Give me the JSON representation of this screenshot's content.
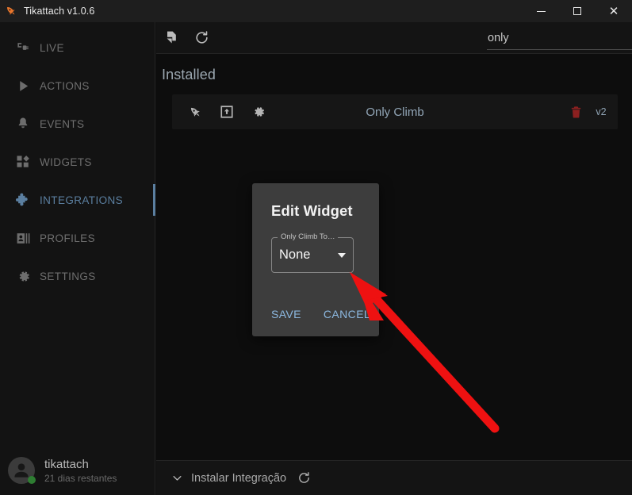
{
  "window": {
    "title": "Tikattach v1.0.6",
    "app_icon": "rocket-icon",
    "minimize_label": "",
    "maximize_label": "",
    "close_label": "✕"
  },
  "sidebar": {
    "items": [
      {
        "label": "LIVE",
        "icon": "plug-icon",
        "active": false
      },
      {
        "label": "ACTIONS",
        "icon": "play-icon",
        "active": false
      },
      {
        "label": "EVENTS",
        "icon": "bell-icon",
        "active": false
      },
      {
        "label": "WIDGETS",
        "icon": "widgets-icon",
        "active": false
      },
      {
        "label": "INTEGRATIONS",
        "icon": "puzzle-icon",
        "active": true
      },
      {
        "label": "PROFILES",
        "icon": "profile-card-icon",
        "active": false
      },
      {
        "label": "SETTINGS",
        "icon": "gear-icon",
        "active": false
      }
    ],
    "user": {
      "name": "tikattach",
      "subtitle": "21 dias restantes",
      "status_color": "#2e7d32"
    }
  },
  "toolbar": {
    "new_file_icon": "file-add-icon",
    "refresh_icon": "refresh-icon",
    "search": {
      "value": "only",
      "placeholder": ""
    }
  },
  "main": {
    "section_title": "Installed",
    "rows": [
      {
        "name": "Only Climb",
        "version": "v2",
        "icons": [
          "rocket-icon",
          "export-icon",
          "gear-icon"
        ],
        "delete_icon": "trash-icon"
      }
    ]
  },
  "bottom_bar": {
    "chevron_icon": "chevron-down-icon",
    "label": "Instalar Integração",
    "refresh_icon": "refresh-icon"
  },
  "dialog": {
    "title": "Edit Widget",
    "field": {
      "label": "Only Climb To…",
      "value": "None",
      "caret_icon": "chevron-down-icon"
    },
    "save_label": "SAVE",
    "cancel_label": "CANCEL"
  },
  "annotation": {
    "arrow_color": "#ee1111",
    "points_at": "widget-select-caret"
  },
  "colors": {
    "accent_blue": "#5b7fa0",
    "link_blue": "#8cb8e0",
    "danger_red": "#8c2020",
    "window_bg": "#0d0d0d",
    "dialog_bg": "#3d3d3d"
  }
}
